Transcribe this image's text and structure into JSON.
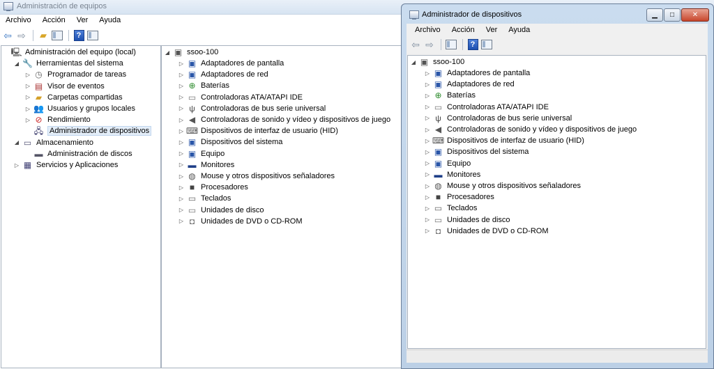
{
  "main_window": {
    "title": "Administración de equipos",
    "menu": [
      "Archivo",
      "Acción",
      "Ver",
      "Ayuda"
    ],
    "toolbar_icons": [
      "back-arrow-icon",
      "forward-arrow-icon",
      "up-folder-icon",
      "show-hide-tree-icon",
      "help-icon",
      "properties-icon"
    ],
    "tree": [
      {
        "label": "Administración del equipo (local)",
        "icon": "computer-management-icon",
        "level": 0,
        "expander": "",
        "selected": false
      },
      {
        "label": "Herramientas del sistema",
        "icon": "tools-icon",
        "level": 1,
        "expander": "expanded",
        "selected": false
      },
      {
        "label": "Programador de tareas",
        "icon": "clock-icon",
        "level": 2,
        "expander": "collapsed",
        "selected": false
      },
      {
        "label": "Visor de eventos",
        "icon": "event-viewer-icon",
        "level": 2,
        "expander": "collapsed",
        "selected": false
      },
      {
        "label": "Carpetas compartidas",
        "icon": "shared-folder-icon",
        "level": 2,
        "expander": "collapsed",
        "selected": false
      },
      {
        "label": "Usuarios y grupos locales",
        "icon": "users-icon",
        "level": 2,
        "expander": "collapsed",
        "selected": false
      },
      {
        "label": "Rendimiento",
        "icon": "performance-icon",
        "level": 2,
        "expander": "collapsed",
        "selected": false
      },
      {
        "label": "Administrador de dispositivos",
        "icon": "device-manager-icon",
        "level": 2,
        "expander": "",
        "selected": true
      },
      {
        "label": "Almacenamiento",
        "icon": "storage-icon",
        "level": 1,
        "expander": "expanded",
        "selected": false
      },
      {
        "label": "Administración de discos",
        "icon": "disk-icon",
        "level": 2,
        "expander": "",
        "selected": false
      },
      {
        "label": "Servicios y Aplicaciones",
        "icon": "services-icon",
        "level": 1,
        "expander": "collapsed",
        "selected": false
      }
    ],
    "device_root": "ssoo-100"
  },
  "devices": [
    {
      "label": "Adaptadores de pantalla",
      "icon": "display-adapter-icon"
    },
    {
      "label": "Adaptadores de red",
      "icon": "network-adapter-icon"
    },
    {
      "label": "Baterías",
      "icon": "battery-icon"
    },
    {
      "label": "Controladoras ATA/ATAPI IDE",
      "icon": "ide-controller-icon"
    },
    {
      "label": "Controladoras de bus serie universal",
      "icon": "usb-controller-icon"
    },
    {
      "label": "Controladoras de sonido y vídeo y dispositivos de juego",
      "icon": "sound-icon"
    },
    {
      "label": "Dispositivos de interfaz de usuario (HID)",
      "icon": "hid-icon"
    },
    {
      "label": "Dispositivos del sistema",
      "icon": "system-devices-icon"
    },
    {
      "label": "Equipo",
      "icon": "computer-icon"
    },
    {
      "label": "Monitores",
      "icon": "monitor-icon"
    },
    {
      "label": "Mouse y otros dispositivos señaladores",
      "icon": "mouse-icon"
    },
    {
      "label": "Procesadores",
      "icon": "processor-icon"
    },
    {
      "label": "Teclados",
      "icon": "keyboard-icon"
    },
    {
      "label": "Unidades de disco",
      "icon": "disk-drive-icon"
    },
    {
      "label": "Unidades de DVD o CD-ROM",
      "icon": "dvd-drive-icon"
    }
  ],
  "device_window": {
    "title": "Administrador de dispositivos",
    "menu": [
      "Archivo",
      "Acción",
      "Ver",
      "Ayuda"
    ],
    "device_root": "ssoo-100",
    "caption_buttons": {
      "minimize": "▁",
      "maximize": "□",
      "close": "✕"
    }
  },
  "colors": {
    "selection": "#e3edf8",
    "titlebar": "#d7e4f2"
  }
}
